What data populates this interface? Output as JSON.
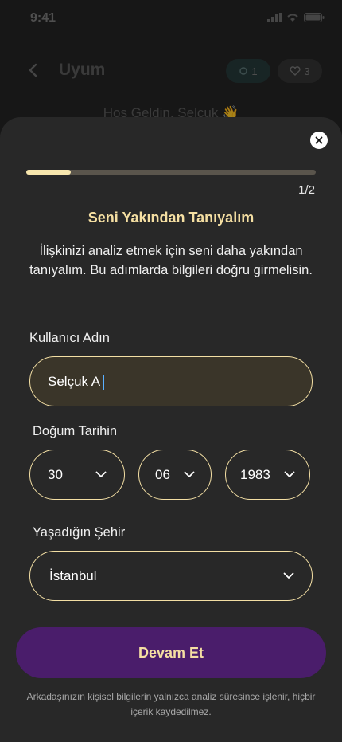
{
  "status_bar": {
    "time": "9:41"
  },
  "background": {
    "title": "Uyum",
    "pill_1": "1",
    "pill_2": "3",
    "welcome": "Hoş Geldin, Selçuk 👋"
  },
  "sheet": {
    "progress": {
      "fraction": 0.155,
      "label": "1/2"
    },
    "title": "Seni Yakından Tanıyalım",
    "description": "İlişkinizi analiz etmek için seni daha yakından tanıyalım. Bu adımlarda bilgileri doğru girmelisin.",
    "username": {
      "label": "Kullanıcı Adın",
      "value": "Selçuk A"
    },
    "birth_date": {
      "label": "Doğum Tarihin",
      "day": "30",
      "month": "06",
      "year": "1983"
    },
    "city": {
      "label": "Yaşadığın Şehir",
      "value": "İstanbul"
    },
    "continue_label": "Devam Et",
    "privacy_note": "Arkadaşınızın kişisel bilgilerin yalnızca analiz süresince işlenir, hiçbir içerik kaydedilmez."
  },
  "colors": {
    "accent": "#f5dfa2",
    "button": "#4a1d6b",
    "sheet_bg": "#282828"
  }
}
